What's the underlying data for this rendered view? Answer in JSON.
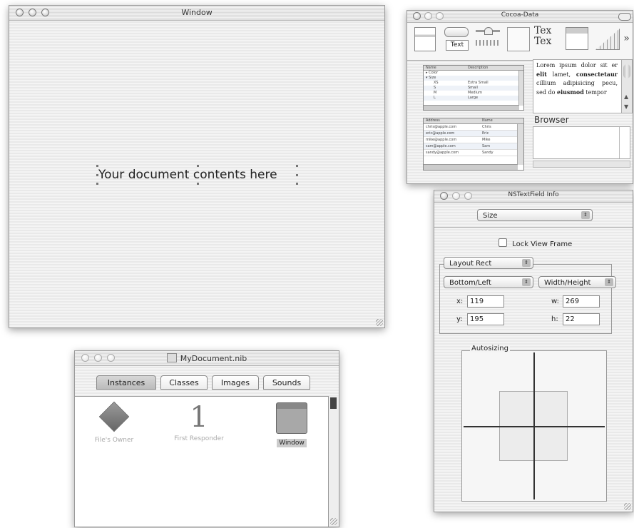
{
  "document_window": {
    "title": "Window",
    "content_text": "Your document contents here"
  },
  "palette": {
    "title": "Cocoa-Data",
    "toolbar": {
      "text_button": "Text",
      "text_field_preview": "Tex",
      "text_field_preview_2": "Tex",
      "more_arrow": "»"
    },
    "outline_view": {
      "headers": [
        "Name",
        "Description"
      ],
      "rows": [
        [
          "▸ Color",
          ""
        ],
        [
          "▾ Size",
          ""
        ],
        [
          "XS",
          "Extra Small"
        ],
        [
          "S",
          "Small"
        ],
        [
          "M",
          "Medium"
        ],
        [
          "L",
          "Large"
        ]
      ]
    },
    "text_view_html": "Lorem ipsum dolor sit er <b>elit</b> lamet, <b>consectetaur</b> cillium adipisicing pecu, sed do <b>eiusmod</b> tempor",
    "table_view": {
      "headers": [
        "Address",
        "Name"
      ],
      "rows": [
        [
          "chris@apple.com",
          "Chris"
        ],
        [
          "eric@apple.com",
          "Eric"
        ],
        [
          "mike@apple.com",
          "Mike"
        ],
        [
          "sam@apple.com",
          "Sam"
        ],
        [
          "sandy@apple.com",
          "Sandy"
        ]
      ]
    },
    "browser_label": "Browser"
  },
  "info_panel": {
    "title": "NSTextField Info",
    "section_popup": "Size",
    "lock_view_frame": "Lock View Frame",
    "layout_popup": "Layout Rect",
    "origin_popup": "Bottom/Left",
    "size_popup": "Width/Height",
    "x_label": "x:",
    "x_value": "119",
    "y_label": "y:",
    "y_value": "195",
    "w_label": "w:",
    "w_value": "269",
    "h_label": "h:",
    "h_value": "22",
    "autosizing_label": "Autosizing"
  },
  "nib_window": {
    "title": "MyDocument.nib",
    "tabs": [
      "Instances",
      "Classes",
      "Images",
      "Sounds"
    ],
    "selected_tab": "Instances",
    "instances": [
      {
        "label": "File's Owner",
        "icon": "cube-icon"
      },
      {
        "label": "First Responder",
        "icon": "first-responder-icon"
      },
      {
        "label": "Window",
        "icon": "window-icon"
      }
    ]
  }
}
